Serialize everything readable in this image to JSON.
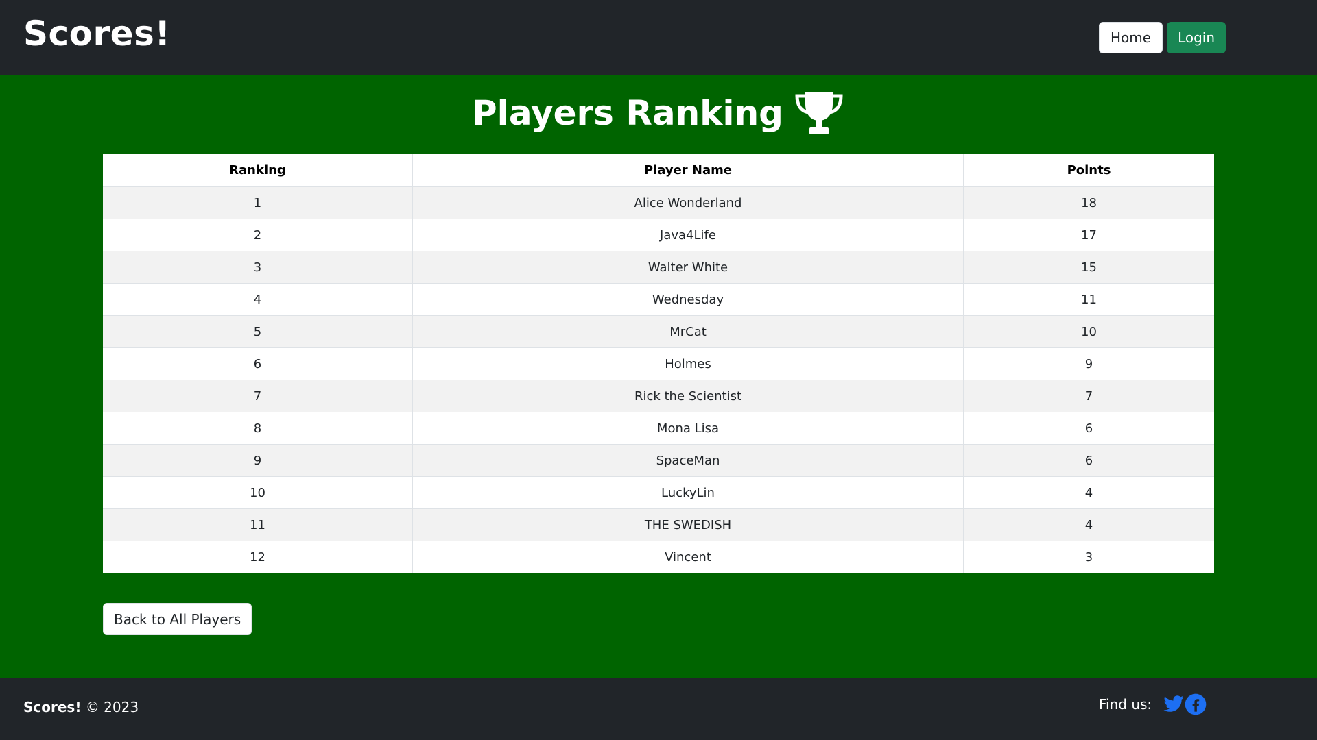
{
  "header": {
    "brand": "Scores!",
    "nav": {
      "home_label": "Home",
      "login_label": "Login"
    }
  },
  "main": {
    "title": "Players Ranking",
    "title_icon": "trophy-icon",
    "table": {
      "headers": [
        "Ranking",
        "Player Name",
        "Points"
      ],
      "rows": [
        {
          "rank": "1",
          "name": "Alice Wonderland",
          "points": "18"
        },
        {
          "rank": "2",
          "name": "Java4Life",
          "points": "17"
        },
        {
          "rank": "3",
          "name": "Walter White",
          "points": "15"
        },
        {
          "rank": "4",
          "name": "Wednesday",
          "points": "11"
        },
        {
          "rank": "5",
          "name": "MrCat",
          "points": "10"
        },
        {
          "rank": "6",
          "name": "Holmes",
          "points": "9"
        },
        {
          "rank": "7",
          "name": "Rick the Scientist",
          "points": "7"
        },
        {
          "rank": "8",
          "name": "Mona Lisa",
          "points": "6"
        },
        {
          "rank": "9",
          "name": "SpaceMan",
          "points": "6"
        },
        {
          "rank": "10",
          "name": "LuckyLin",
          "points": "4"
        },
        {
          "rank": "11",
          "name": "THE SWEDISH",
          "points": "4"
        },
        {
          "rank": "12",
          "name": "Vincent",
          "points": "3"
        }
      ]
    },
    "back_label": "Back to All Players"
  },
  "footer": {
    "brand": "Scores!",
    "copyright": "© 2023",
    "find_us": "Find us:",
    "social": [
      "twitter-icon",
      "facebook-icon"
    ]
  },
  "colors": {
    "header_bg": "#212529",
    "main_bg": "#006400",
    "login_bg": "#198754",
    "social_blue": "#1d6ff2"
  }
}
